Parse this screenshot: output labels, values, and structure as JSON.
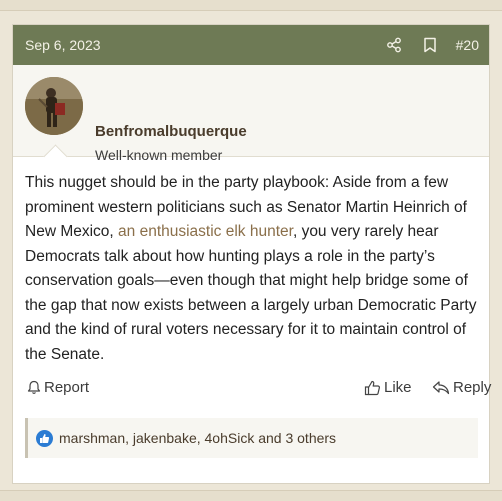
{
  "post": {
    "date": "Sep 6, 2023",
    "number": "#20",
    "header_icons": [
      "share-icon",
      "bookmark-icon"
    ],
    "author": {
      "username": "Benfromalbuquerque",
      "title": "Well-known member"
    },
    "body": {
      "text_before_link": "This nugget should be in the party playbook: Aside from a few prominent western politicians such as Senator Martin Heinrich of New Mexico, ",
      "link_text": "an enthusiastic elk hunter",
      "text_after_link": ", you very rarely hear Democrats talk about how hunting plays a role in the party’s conservation goals—even though that might help bridge some of the gap that now exists between a largely urban Democratic Party and the kind of rural voters necessary for it to maintain control of the Senate."
    },
    "actions": {
      "report_label": "Report",
      "like_label": "Like",
      "reply_label": "Reply"
    },
    "reactions": {
      "text": "marshman, jakenbake, 4ohSick and 3 others"
    }
  },
  "colors": {
    "header_bg": "#6e7a55",
    "link": "#8a6f4a",
    "like_badge": "#2b7cd3",
    "page_bg": "#ece6d7"
  }
}
